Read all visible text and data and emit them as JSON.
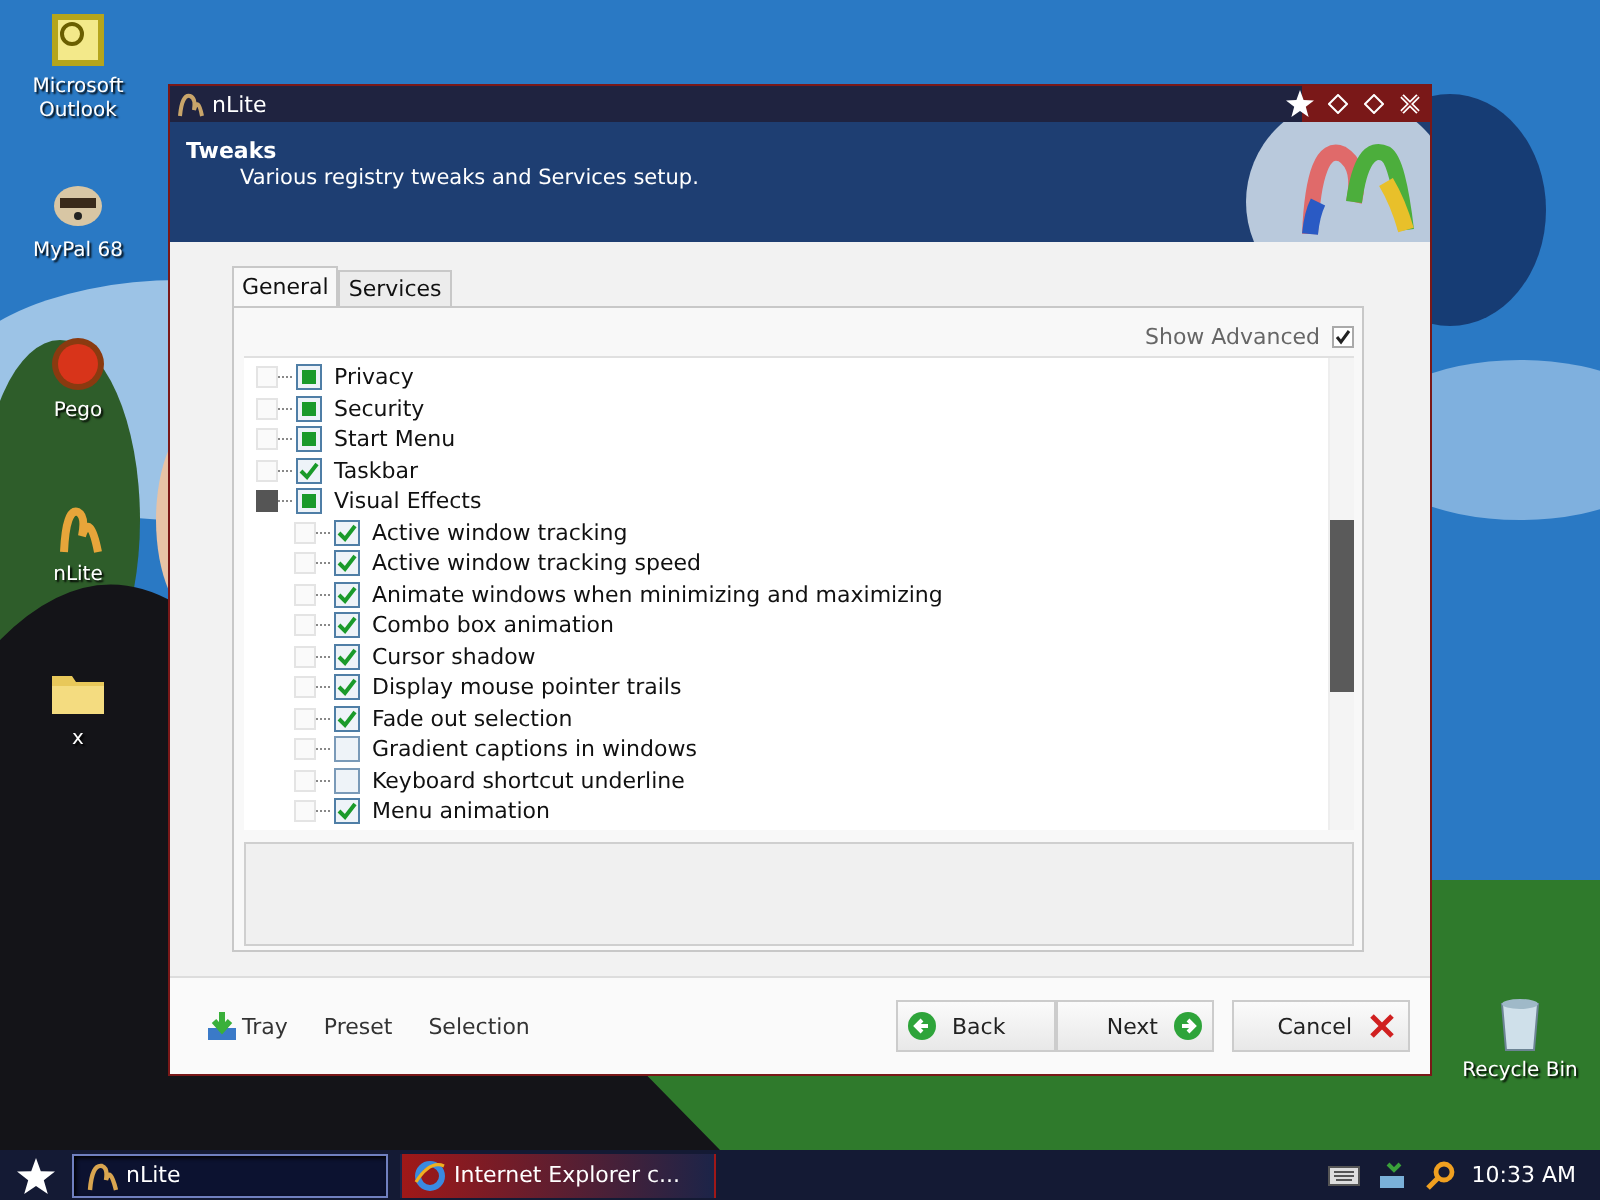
{
  "desktop_icons": [
    {
      "label": "Microsoft\nOutlook",
      "kind": "outlook"
    },
    {
      "label": "MyPal 68",
      "kind": "raccoon"
    },
    {
      "label": "Pego",
      "kind": "ball"
    },
    {
      "label": "nLite",
      "kind": "nlite"
    },
    {
      "label": "x",
      "kind": "folder"
    },
    {
      "label": "Recycle Bin",
      "kind": "bin"
    }
  ],
  "window": {
    "title": "nLite",
    "header_title": "Tweaks",
    "header_subtitle": "Various registry tweaks and Services setup."
  },
  "tabs": [
    {
      "label": "General",
      "selected": true
    },
    {
      "label": "Services",
      "selected": false
    }
  ],
  "show_advanced": {
    "label": "Show Advanced",
    "checked": true
  },
  "tree": [
    {
      "label": "Privacy",
      "checked": true,
      "partial": true
    },
    {
      "label": "Security",
      "checked": true,
      "partial": true
    },
    {
      "label": "Start Menu",
      "checked": true,
      "partial": true
    },
    {
      "label": "Taskbar",
      "checked": true,
      "partial": false
    },
    {
      "label": "Visual Effects",
      "checked": true,
      "partial": true,
      "expanded": true,
      "children": [
        {
          "label": "Active window tracking",
          "checked": true,
          "partial": false
        },
        {
          "label": "Active window tracking speed",
          "checked": true,
          "partial": false
        },
        {
          "label": "Animate windows when minimizing and maximizing",
          "checked": true,
          "partial": false
        },
        {
          "label": "Combo box animation",
          "checked": true,
          "partial": false
        },
        {
          "label": "Cursor shadow",
          "checked": true,
          "partial": false
        },
        {
          "label": "Display mouse pointer trails",
          "checked": true,
          "partial": false
        },
        {
          "label": "Fade out selection",
          "checked": true,
          "partial": false
        },
        {
          "label": "Gradient captions in windows",
          "checked": false,
          "partial": false
        },
        {
          "label": "Keyboard shortcut underline",
          "checked": false,
          "partial": false
        },
        {
          "label": "Menu animation",
          "checked": true,
          "partial": false
        }
      ]
    }
  ],
  "footer_links": [
    {
      "label": "Tray",
      "kind": "tray"
    },
    {
      "label": "Preset",
      "kind": "plain"
    },
    {
      "label": "Selection",
      "kind": "plain"
    }
  ],
  "buttons": [
    {
      "label": "Back",
      "kind": "back"
    },
    {
      "label": "Next",
      "kind": "next"
    },
    {
      "label": "Cancel",
      "kind": "cancel"
    }
  ],
  "taskbar": {
    "items": [
      {
        "label": "nLite",
        "kind": "nlite",
        "selected": true
      },
      {
        "label": "Internet Explorer c...",
        "kind": "ie",
        "selected": false
      }
    ],
    "clock": "10:33 AM"
  }
}
